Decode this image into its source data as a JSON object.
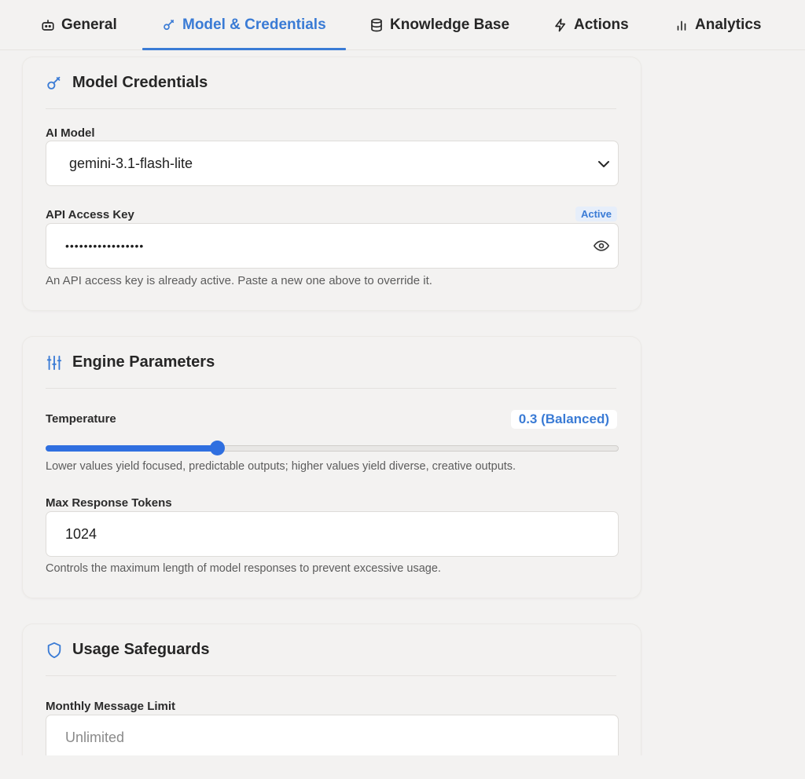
{
  "tabs": [
    {
      "label": "General",
      "icon": "bot-icon"
    },
    {
      "label": "Model & Credentials",
      "icon": "key-icon"
    },
    {
      "label": "Knowledge Base",
      "icon": "database-icon"
    },
    {
      "label": "Actions",
      "icon": "lightning-icon"
    },
    {
      "label": "Analytics",
      "icon": "bar-chart-icon"
    }
  ],
  "active_tab": "Model & Credentials",
  "accent_color": "#3a7bd5",
  "credentials": {
    "title": "Model Credentials",
    "model_label": "AI Model",
    "model_value": "gemini-3.1-flash-lite",
    "key_label": "API Access Key",
    "key_status": "Active",
    "key_value": "•••••••••••••••••",
    "key_hint": "An API access key is already active. Paste a new one above to override it."
  },
  "engine": {
    "title": "Engine Parameters",
    "temperature_label": "Temperature",
    "temperature_display": "0.3 (Balanced)",
    "temperature_value": 0.3,
    "temperature_hint": "Lower values yield focused, predictable outputs; higher values yield diverse, creative outputs.",
    "tokens_label": "Max Response Tokens",
    "tokens_value": "1024",
    "tokens_hint": "Controls the maximum length of model responses to prevent excessive usage."
  },
  "safeguards": {
    "title": "Usage Safeguards",
    "limit_label": "Monthly Message Limit",
    "limit_placeholder": "Unlimited"
  }
}
